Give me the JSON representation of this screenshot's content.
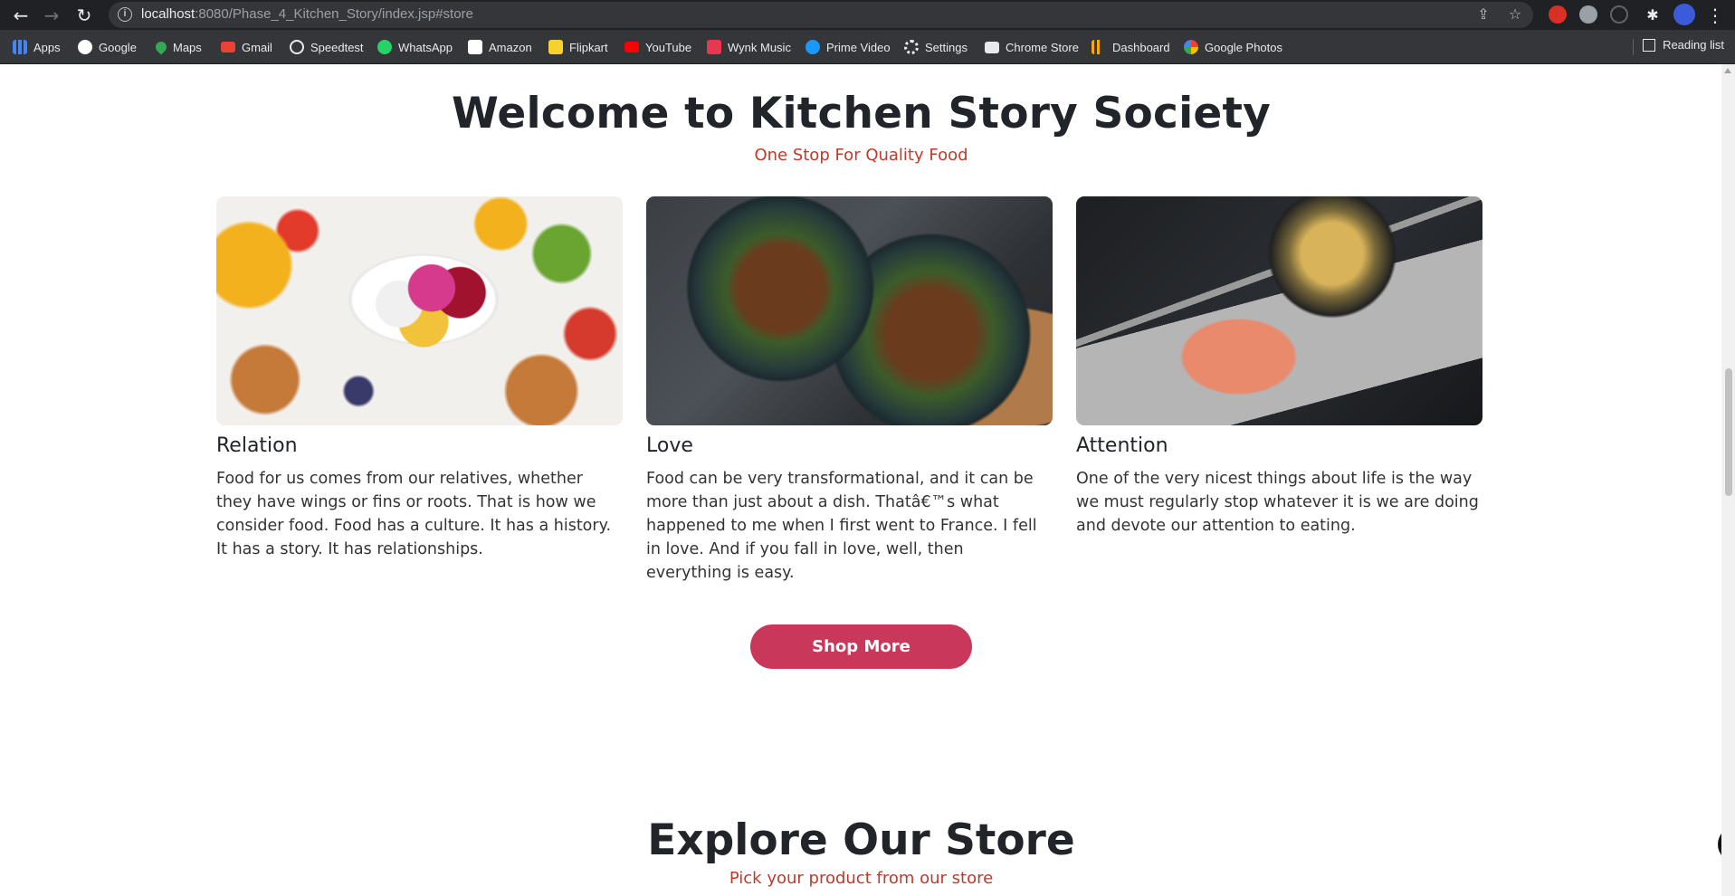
{
  "browser": {
    "url_host": "localhost",
    "url_rest": ":8080/Phase_4_Kitchen_Story/index.jsp#store",
    "back_icon": "←",
    "forward_icon": "→",
    "reload_icon": "↻",
    "share_icon": "⇪",
    "star_icon": "☆",
    "puzzle_icon": "✱",
    "menu_icon": "⋮",
    "info_icon": "i"
  },
  "bookmarks": [
    {
      "label": "Apps",
      "color": "#4285f4"
    },
    {
      "label": "Google",
      "color": "#ea4335"
    },
    {
      "label": "Maps",
      "color": "#34a853"
    },
    {
      "label": "Gmail",
      "color": "#ea4335"
    },
    {
      "label": "Speedtest",
      "color": "#9aa0a6"
    },
    {
      "label": "WhatsApp",
      "color": "#25d366"
    },
    {
      "label": "Amazon",
      "color": "#ff9900"
    },
    {
      "label": "Flipkart",
      "color": "#f7d22e"
    },
    {
      "label": "YouTube",
      "color": "#ff0000"
    },
    {
      "label": "Wynk Music",
      "color": "#e8384f"
    },
    {
      "label": "Prime Video",
      "color": "#1a98ff"
    },
    {
      "label": "Settings",
      "color": "#9aa0a6"
    },
    {
      "label": "Chrome Store",
      "color": "#e8eaed"
    },
    {
      "label": "Dashboard",
      "color": "#f9ab00"
    },
    {
      "label": "Google Photos",
      "color": "#fbbc04"
    }
  ],
  "reading_list": "Reading list",
  "page": {
    "title": "Welcome to Kitchen Story Society",
    "subtitle": "One Stop For Quality Food",
    "cards": [
      {
        "title": "Relation",
        "text": "Food for us comes from our relatives, whether they have wings or fins or roots. That is how we consider food. Food has a culture. It has a history. It has a story. It has relationships."
      },
      {
        "title": "Love",
        "text": "Food can be very transformational, and it can be more than just about a dish. Thatâ€™s what happened to me when I first went to France. I fell in love. And if you fall in love, well, then everything is easy."
      },
      {
        "title": "Attention",
        "text": "One of the very nicest things about life is the way we must regularly stop whatever it is we are doing and devote our attention to eating."
      }
    ],
    "shop_button": "Shop More",
    "store_title": "Explore Our Store",
    "store_subtitle": "Pick your product from our store"
  },
  "colors": {
    "accent": "#c9375a",
    "subtitle_red": "#c0392b"
  }
}
